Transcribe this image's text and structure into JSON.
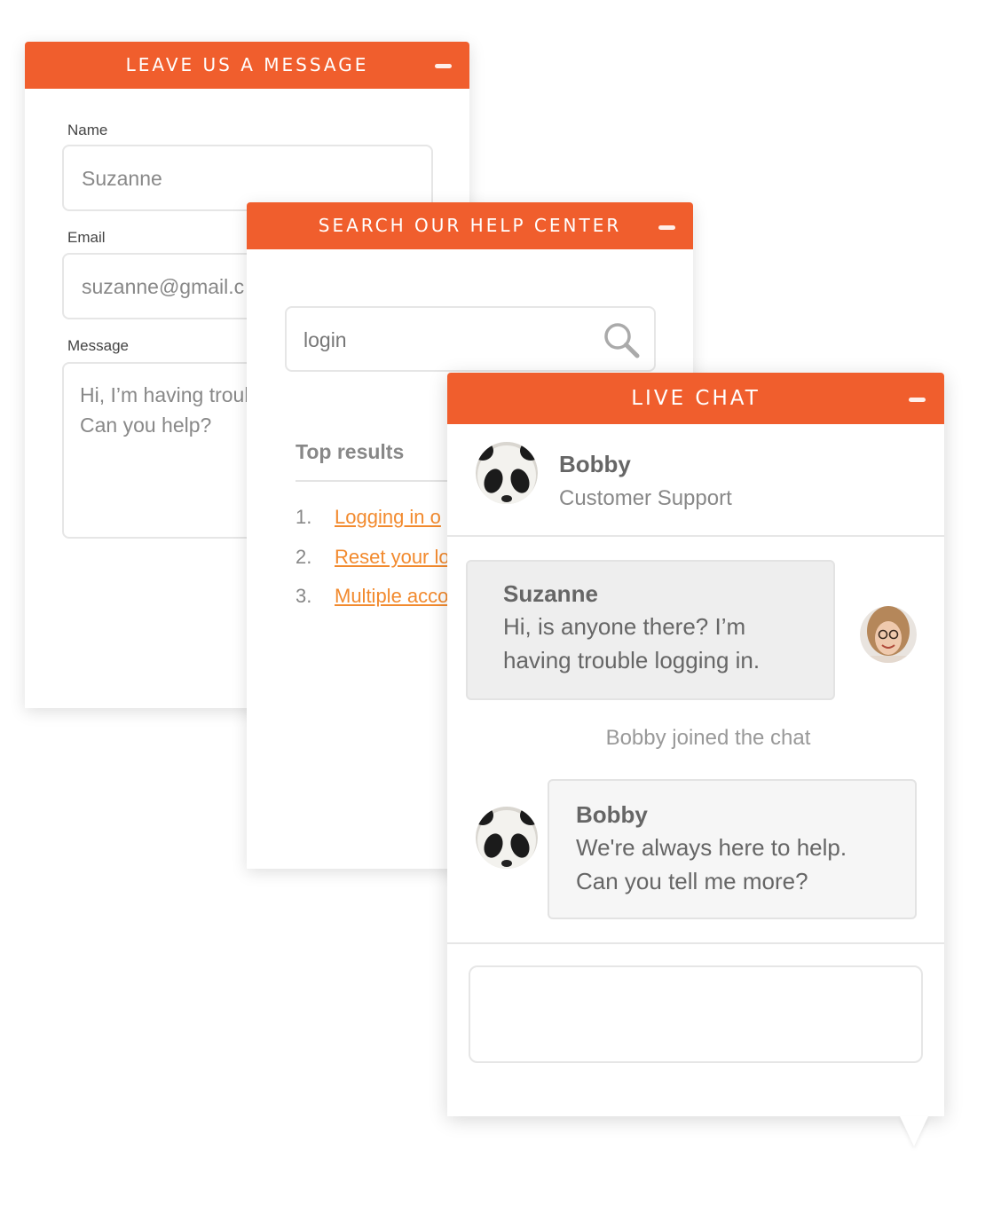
{
  "colors": {
    "accent": "#f05e2d",
    "link": "#f28a2e"
  },
  "message_panel": {
    "title": "LEAVE US A MESSAGE",
    "name_label": "Name",
    "name_value": "Suzanne",
    "email_label": "Email",
    "email_value": "suzanne@gmail.c",
    "message_label": "Message",
    "message_value": "Hi, I’m having troub\nCan you help?"
  },
  "help_panel": {
    "title": "SEARCH OUR HELP CENTER",
    "search_value": "login",
    "top_results_title": "Top results",
    "results": [
      {
        "num": "1.",
        "label": "Logging in o"
      },
      {
        "num": "2.",
        "label": "Reset your lo"
      },
      {
        "num": "3.",
        "label": "Multiple acco"
      }
    ]
  },
  "chat_panel": {
    "title": "LIVE CHAT",
    "agent_name": "Bobby",
    "agent_role": "Customer Support",
    "messages": [
      {
        "sender": "Suzanne",
        "text": "Hi, is anyone there? I’m\nhaving trouble logging in."
      },
      {
        "sender": "Bobby",
        "text": "We're always here to help.\nCan you tell me more?"
      }
    ],
    "system_message": "Bobby joined the chat"
  }
}
